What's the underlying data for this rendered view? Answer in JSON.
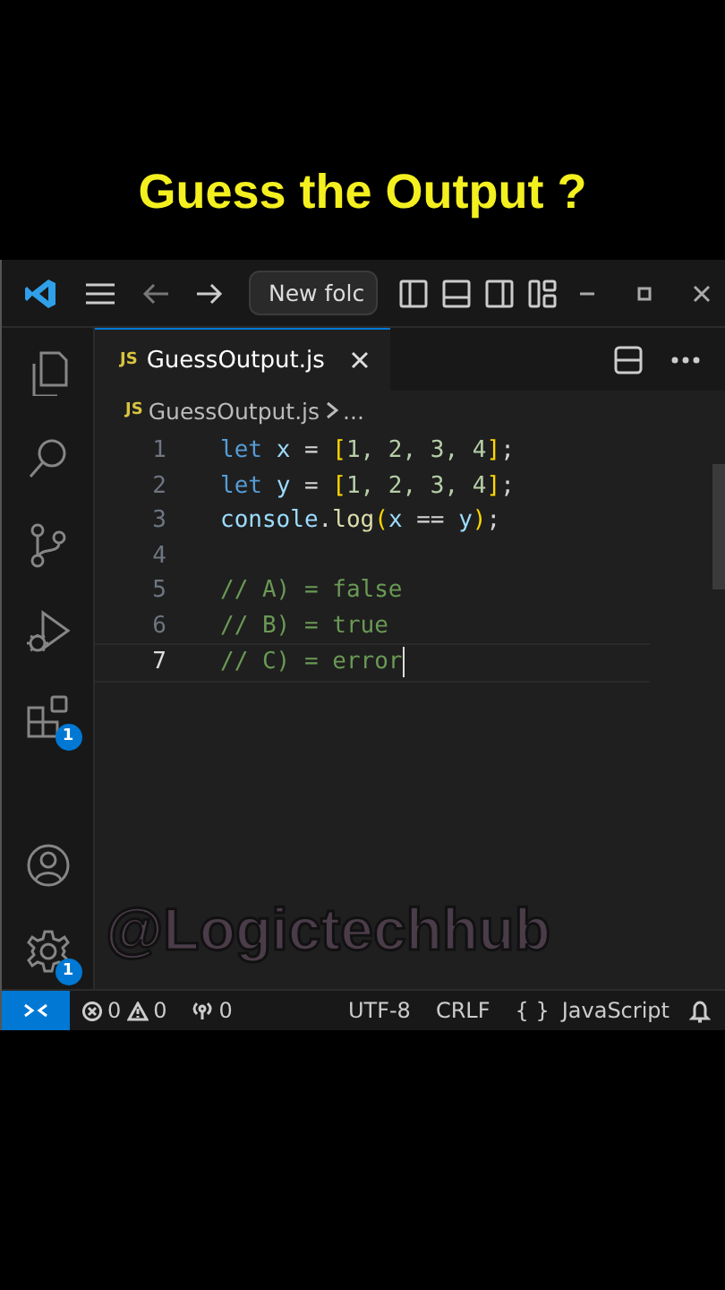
{
  "headline": "Guess the Output ?",
  "title_bar": {
    "command_center": "New folc"
  },
  "activity_bar": [
    {
      "selected": false
    },
    {
      "selected": false
    },
    {
      "selected": false
    },
    {
      "selected": false
    },
    {
      "selected": false,
      "badge": "1"
    },
    {
      "selected": false
    },
    {
      "selected": false,
      "badge": "1"
    }
  ],
  "tabs": [
    {
      "label": "GuessOutput.js",
      "badge": "JS",
      "selected": true
    }
  ],
  "breadcrumb": {
    "badge": "JS",
    "file": "GuessOutput.js",
    "rest": "..."
  },
  "code_lines": [
    {
      "number": "1",
      "current": false,
      "tokens": [
        {
          "text": "let ",
          "kind": "keyword"
        },
        {
          "text": "x",
          "kind": "variable"
        },
        {
          "text": " = ",
          "kind": "plain"
        },
        {
          "text": "[",
          "kind": "bracket"
        },
        {
          "text": "1, 2, 3, 4",
          "kind": "number"
        },
        {
          "text": "]",
          "kind": "bracket"
        },
        {
          "text": ";",
          "kind": "plain"
        }
      ]
    },
    {
      "number": "2",
      "current": false,
      "tokens": [
        {
          "text": "let ",
          "kind": "keyword"
        },
        {
          "text": "y",
          "kind": "variable"
        },
        {
          "text": " = ",
          "kind": "plain"
        },
        {
          "text": "[",
          "kind": "bracket"
        },
        {
          "text": "1, 2, 3, 4",
          "kind": "number"
        },
        {
          "text": "]",
          "kind": "bracket"
        },
        {
          "text": ";",
          "kind": "plain"
        }
      ]
    },
    {
      "number": "3",
      "current": false,
      "tokens": [
        {
          "text": "console",
          "kind": "variable"
        },
        {
          "text": ".",
          "kind": "plain"
        },
        {
          "text": "log",
          "kind": "function"
        },
        {
          "text": "(",
          "kind": "bracket"
        },
        {
          "text": "x",
          "kind": "variable"
        },
        {
          "text": " == ",
          "kind": "plain"
        },
        {
          "text": "y",
          "kind": "variable"
        },
        {
          "text": ")",
          "kind": "bracket"
        },
        {
          "text": ";",
          "kind": "plain"
        }
      ]
    },
    {
      "number": "4",
      "current": false
    },
    {
      "number": "5",
      "current": false,
      "tokens": [
        {
          "text": "// A) = false",
          "kind": "comment"
        }
      ]
    },
    {
      "number": "6",
      "current": false,
      "tokens": [
        {
          "text": "// B) = true",
          "kind": "comment"
        }
      ]
    },
    {
      "number": "7",
      "current": true,
      "tokens": [
        {
          "text": "// C) = error",
          "kind": "comment"
        }
      ]
    }
  ],
  "status_bar": {
    "errors": "0",
    "warnings": "0",
    "ports": "0",
    "encoding": "UTF-8",
    "eol": "CRLF",
    "language_icon": "{ }",
    "language": "JavaScript"
  },
  "overlay_handle": "@Logictechhub"
}
